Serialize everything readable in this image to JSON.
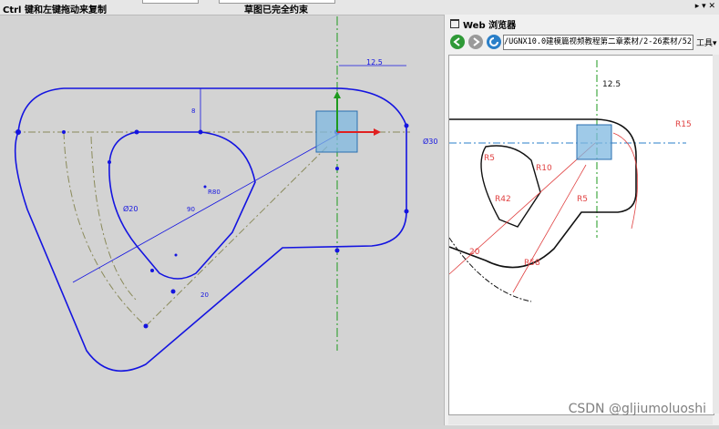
{
  "status": {
    "hint": "Ctrl 键和左键拖动来复制",
    "state": "草图已完全约束"
  },
  "panel": {
    "title": "Web 浏览器",
    "address": "/UGNX10.0建模篇视频教程第二章素材/2-26素材/52.jpg",
    "tools_label": "工具▾"
  },
  "sketch_labels": {
    "dim_12_5": "12.5",
    "dim_8": "8",
    "dim_d30": "Ø30",
    "dim_d20": "Ø20",
    "dim_r80": "R80",
    "dim_90": "90",
    "dim_20": "20"
  },
  "ref_labels": {
    "dim_12_5": "12.5",
    "dim_r15": "R15",
    "dim_r5a": "R5",
    "dim_r10": "R10",
    "dim_r42": "R42",
    "dim_r5b": "R5",
    "dim_r58": "R58",
    "dim_20": "20"
  },
  "watermark": "CSDN @gljiumoluoshi",
  "colors": {
    "sketch": "#1414e0",
    "dash": "#8a8a5a",
    "axis_green": "#1d9a1d",
    "ref_red": "#e04040",
    "ref_black": "#111111"
  },
  "icons": {
    "back": "back-arrow-icon",
    "forward": "forward-arrow-icon",
    "refresh": "refresh-icon"
  }
}
